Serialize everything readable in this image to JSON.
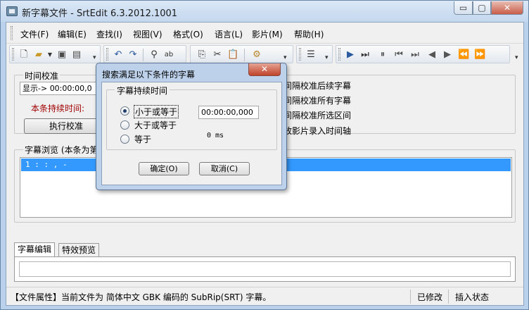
{
  "window": {
    "title": "新字幕文件 - SrtEdit 6.3.2012.1001",
    "min_glyph": "▭",
    "max_glyph": "▢",
    "close_glyph": "✕"
  },
  "menu": [
    "文件(F)",
    "编辑(E)",
    "查找(I)",
    "视图(V)",
    "格式(O)",
    "语言(L)",
    "影片(M)",
    "帮助(H)"
  ],
  "toolbar": {
    "icons": [
      "new-icon",
      "open-icon",
      "save-icon",
      "save-as-icon",
      "undo-icon",
      "redo-icon",
      "find-icon",
      "replace-icon",
      "copy-icon",
      "cut-icon",
      "paste-icon",
      "properties-icon",
      "list-icon",
      "play-icon",
      "capture-icon",
      "pause-icon",
      "prev-icon",
      "next-icon",
      "back-icon",
      "forward-icon",
      "rewind-icon",
      "fast-forward-icon"
    ]
  },
  "timing": {
    "group_title": "时间校准",
    "display_label": "显示->",
    "display_value": "00:00:00,0",
    "duration_label": "本条持续时间:",
    "execute_button": "执行校准",
    "options": [
      "间隔校准后续字幕",
      "间隔校准所有字幕",
      "间隔校准所选区间",
      "放影片录入时间轴"
    ]
  },
  "browse": {
    "group_title": "字幕浏览 (本条为第",
    "row": "1  :  :  ,   -"
  },
  "dialog": {
    "title": "搜索满足以下条件的字幕",
    "close_glyph": "✕",
    "group_title": "字幕持续时间",
    "options": [
      "小于或等于",
      "大于或等于",
      "等于"
    ],
    "selected_option": "小于或等于",
    "time_value": "00:00:00,000",
    "ms_label": "0 ms",
    "ok_button": "确定(O)",
    "cancel_button": "取消(C)"
  },
  "tabs": [
    "字幕编辑",
    "特效预览"
  ],
  "status": {
    "file_info": "【文件属性】当前文件为 简体中文 GBK 编码的 SubRip(SRT) 字幕。",
    "modified": "已修改",
    "mode": "插入状态"
  },
  "colors": {
    "selection": "#3399ff",
    "duration_label": "#a00000",
    "dialog_frame": "#bdd2ea"
  }
}
